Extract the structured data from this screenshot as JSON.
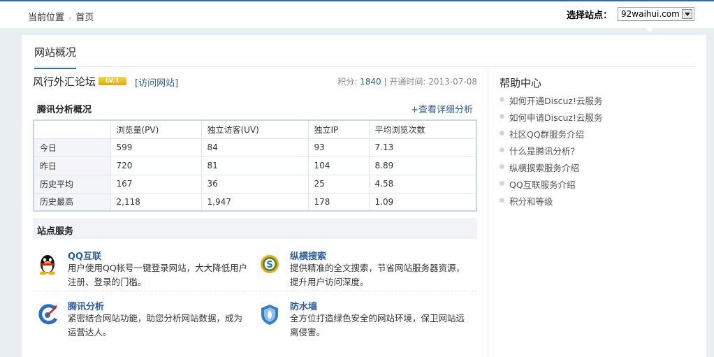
{
  "breadcrumb": {
    "label": "当前位置",
    "current": "首页"
  },
  "site_selector": {
    "label": "选择站点：",
    "value": "92waihui.com"
  },
  "tab": {
    "label": "网站概况"
  },
  "site": {
    "name": "风行外汇论坛",
    "badge": "LV.1",
    "visit_label": "[访问网站]",
    "points_label": "积分:",
    "points": "1840",
    "open_label": "| 开通时间:",
    "open_date": "2013-07-08"
  },
  "analysis": {
    "title": "腾讯分析概况",
    "detail_link": "+查看详细分析",
    "columns": [
      "",
      "浏览量(PV)",
      "独立访客(UV)",
      "独立IP",
      "平均浏览次数"
    ],
    "rows": [
      [
        "今日",
        "599",
        "84",
        "93",
        "7.13"
      ],
      [
        "昨日",
        "720",
        "81",
        "104",
        "8.89"
      ],
      [
        "历史平均",
        "167",
        "36",
        "25",
        "4.58"
      ],
      [
        "历史最高",
        "2,118",
        "1,947",
        "178",
        "1.09"
      ]
    ]
  },
  "services": {
    "title": "站点服务",
    "items": [
      {
        "name": "QQ互联",
        "desc": "用户使用QQ帐号一键登录网站，大大降低用户注册、登录的门槛。",
        "icon": "qq-penguin-icon",
        "color": "#f0b400"
      },
      {
        "name": "纵横搜索",
        "desc": "提供精准的全文搜索，节省网站服务器资源，提升用户访问深度。",
        "icon": "search-s-icon",
        "color": "#3c8c2c"
      },
      {
        "name": "腾讯分析",
        "desc": "紧密结合网站功能，助您分析网站数据，成为运营达人。",
        "icon": "analytics-icon",
        "color": "#2a6fc4"
      },
      {
        "name": "防水墙",
        "desc": "全方位打造绿色安全的网站环境，保卫网站远离侵害。",
        "icon": "shield-icon",
        "color": "#3b7cbf"
      }
    ]
  },
  "help": {
    "title": "帮助中心",
    "items": [
      "如何开通Discuz!云服务",
      "如何申请Discuz!云服务",
      "社区QQ群服务介绍",
      "什么是腾讯分析？",
      "纵横搜索服务介绍",
      "QQ互联服务介绍",
      "积分和等级"
    ]
  }
}
